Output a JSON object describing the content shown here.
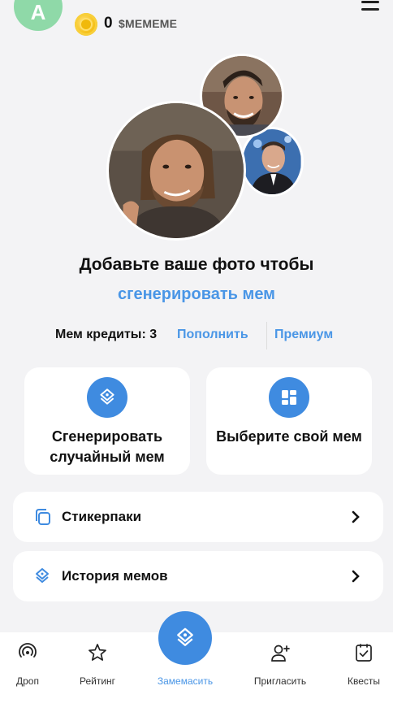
{
  "header": {
    "avatar_letter": "A",
    "balance": "0",
    "ticker": "$MEMEME"
  },
  "main": {
    "title": "Добавьте ваше фото чтобы",
    "generate_link": "сгенерировать мем",
    "credits_label": "Мем кредиты: 3",
    "topup_link": "Пополнить",
    "premium_link": "Премиум"
  },
  "cards": [
    {
      "label": "Сгенерировать случайный мем",
      "icon": "meme-stack-icon"
    },
    {
      "label": "Выберите свой мем",
      "icon": "grid-icon"
    }
  ],
  "rows": [
    {
      "label": "Стикерпаки",
      "icon": "sticker-packs-icon"
    },
    {
      "label": "История мемов",
      "icon": "meme-history-icon"
    }
  ],
  "nav": [
    {
      "label": "Дроп",
      "icon": "drop-icon",
      "active": false
    },
    {
      "label": "Рейтинг",
      "icon": "star-icon",
      "active": false
    },
    {
      "label": "Замемасить",
      "icon": "meme-stack-icon",
      "active": true
    },
    {
      "label": "Пригласить",
      "icon": "invite-icon",
      "active": false
    },
    {
      "label": "Квесты",
      "icon": "quests-icon",
      "active": false
    }
  ],
  "colors": {
    "accent": "#4a96e6",
    "primary_button": "#3f8be0",
    "avatar": "#8fd9a8",
    "background": "#f3f3f5"
  }
}
